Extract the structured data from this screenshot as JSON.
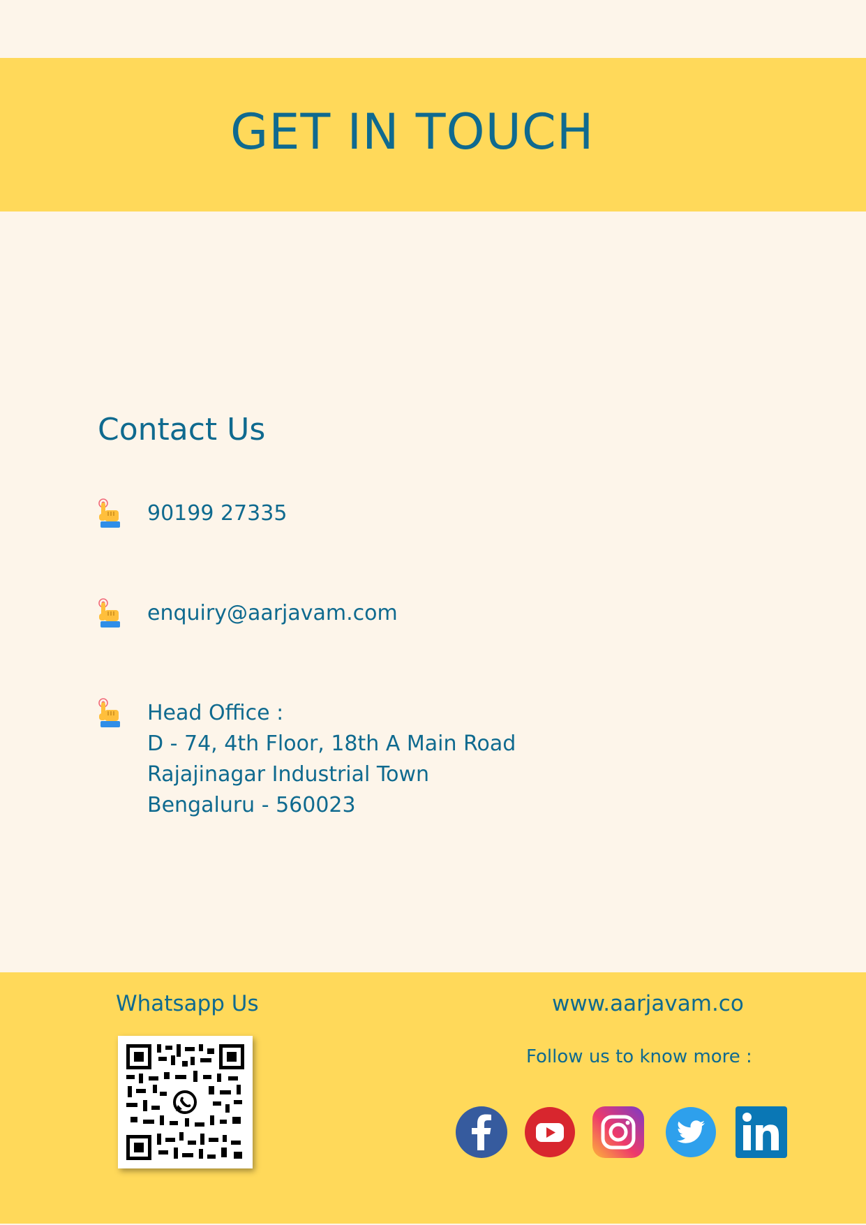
{
  "header": {
    "title": "GET IN TOUCH"
  },
  "contact": {
    "heading": "Contact Us",
    "phone": "90199 27335",
    "email": "enquiry@aarjavam.com",
    "office": {
      "label": "Head Office :",
      "line1": "D - 74, 4th Floor, 18th A Main Road",
      "line2": "Rajajinagar Industrial Town",
      "line3": "Bengaluru - 560023"
    },
    "bullet_icon": "pointing-hand-icon"
  },
  "footer": {
    "whatsapp_label": "Whatsapp Us",
    "website": "www.aarjavam.co",
    "follow_text": "Follow us to know more :",
    "social": [
      "facebook-icon",
      "youtube-icon",
      "instagram-icon",
      "twitter-icon",
      "linkedin-icon"
    ]
  },
  "colors": {
    "page_bg": "#fdf5ea",
    "accent_yellow": "#ffd95a",
    "text_blue": "#0f6a8f"
  }
}
